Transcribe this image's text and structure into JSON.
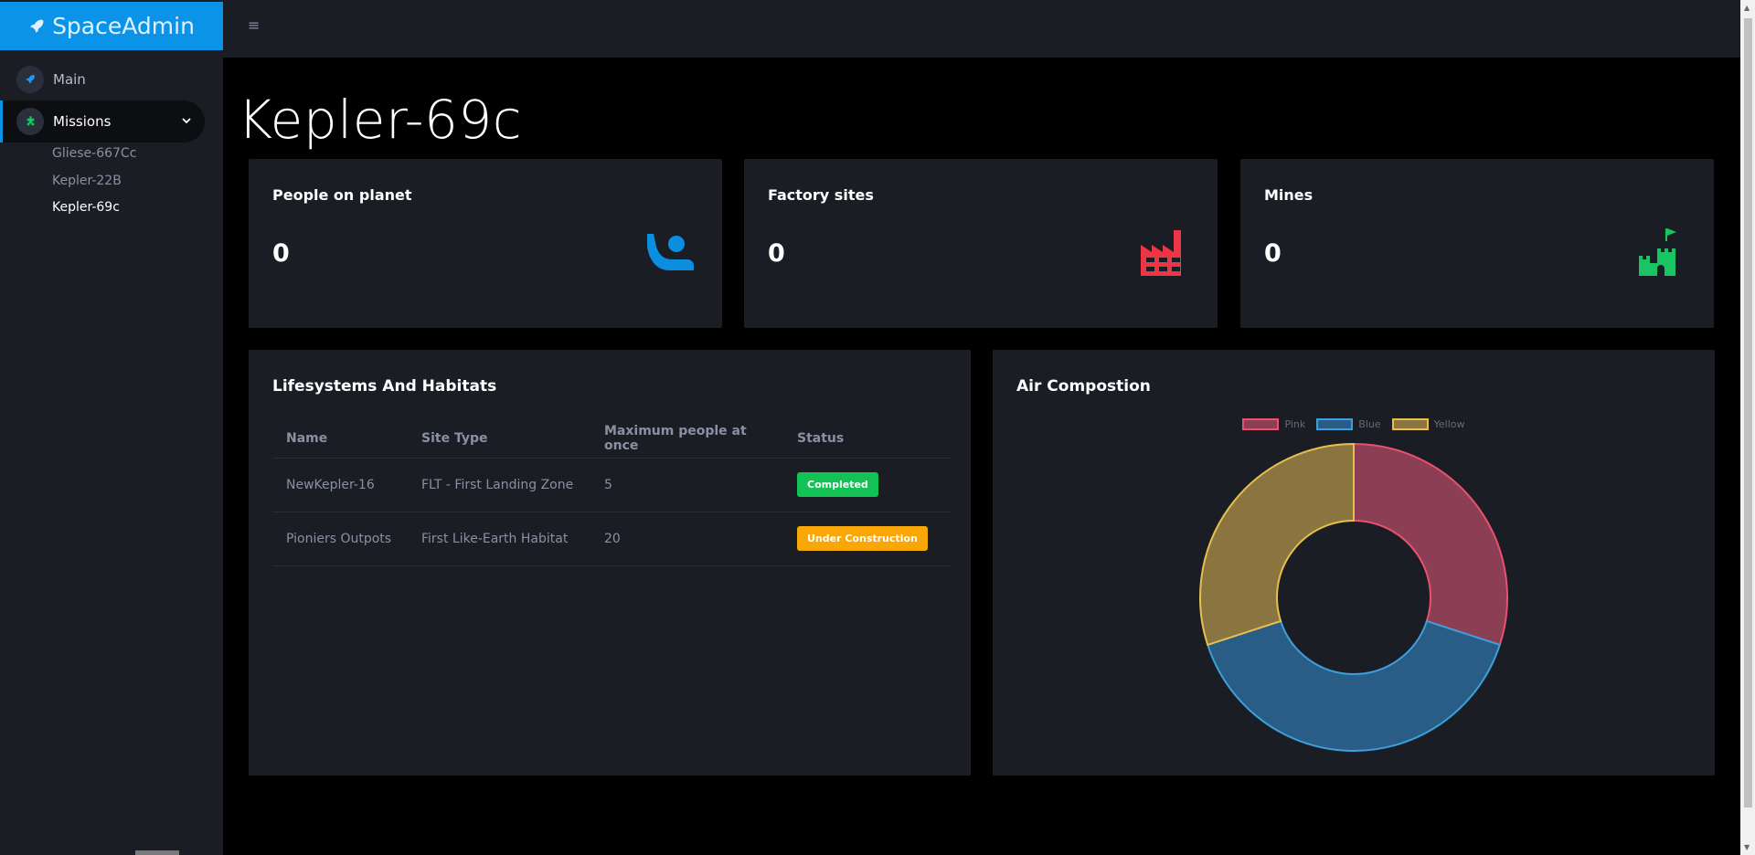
{
  "brand": {
    "name": "SpaceAdmin"
  },
  "sidebar": {
    "items": [
      {
        "label": "Main",
        "icon": "rocket-icon"
      },
      {
        "label": "Missions",
        "icon": "puzzle-icon"
      }
    ],
    "sub_items": [
      "Gliese-667Cc",
      "Kepler-22B",
      "Kepler-69c"
    ]
  },
  "page": {
    "title": "Kepler-69c"
  },
  "stats": [
    {
      "label": "People on planet",
      "value": "0",
      "icon": "person-wave-icon",
      "color": "#0b8ee0"
    },
    {
      "label": "Factory sites",
      "value": "0",
      "icon": "factory-icon",
      "color": "#ed3546"
    },
    {
      "label": "Mines",
      "value": "0",
      "icon": "castle-flag-icon",
      "color": "#19c463"
    }
  ],
  "habitats": {
    "title": "Lifesystems And Habitats",
    "columns": [
      "Name",
      "Site Type",
      "Maximum people at once",
      "Status"
    ],
    "rows": [
      {
        "name": "NewKepler-16",
        "type": "FLT - First Landing Zone",
        "max": "5",
        "status": "Completed",
        "status_color": "#13c255"
      },
      {
        "name": "Pioniers Outpots",
        "type": "First Like-Earth Habitat",
        "max": "20",
        "status": "Under Construction",
        "status_color": "#f9a706"
      }
    ]
  },
  "chart_data": {
    "type": "pie",
    "title": "Air Compostion",
    "categories": [
      "Pink",
      "Blue",
      "Yellow"
    ],
    "values": [
      30,
      40,
      30
    ],
    "colors": {
      "fill": [
        "#8b3e54",
        "#2a5d86",
        "#8a7540"
      ],
      "stroke": [
        "#e9516f",
        "#3c9fde",
        "#e6c04e"
      ]
    },
    "legend_position": "top"
  }
}
